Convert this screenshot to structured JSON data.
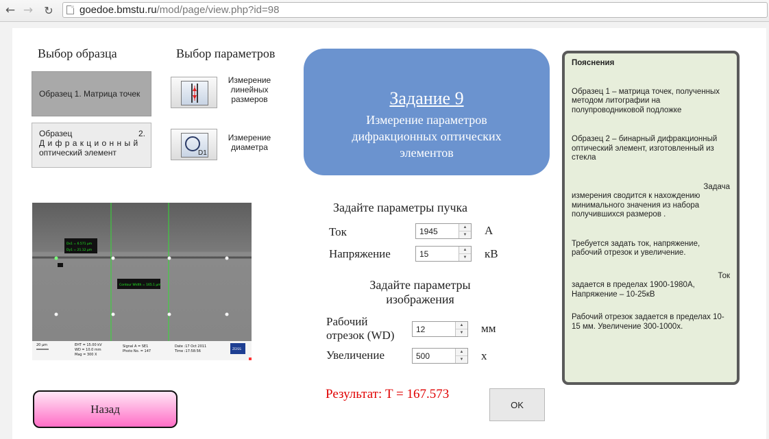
{
  "browser": {
    "url_host": "goedoe.bmstu.ru",
    "url_path": "/mod/page/view.php?id=98"
  },
  "left_panel": {
    "sample_heading": "Выбор образца",
    "param_heading": "Выбор параметров",
    "sample1_label": "Образец 1. Матрица точек",
    "sample2_line1_left": "Образец",
    "sample2_line1_right": "2.",
    "sample2_line2_words": [
      "Д и ф р а к ц и о н н ы й"
    ],
    "sample2_line3": "оптический элемент",
    "param1_label_lines": [
      "Измерение",
      "линейных",
      "размеров"
    ],
    "param2_label_lines": [
      "Измерение",
      "диаметра"
    ],
    "param2_icon_text": "D1"
  },
  "task": {
    "title": "Задание 9",
    "subtitle": "Измерение параметров дифракционных оптических элементов"
  },
  "sem_image": {
    "label_box1_line1": "Dx1 = 6.571 µm",
    "label_box1_line2": "Dy1 = 21.12 µm",
    "label_box2": "Contour Width = 165.1 µm",
    "footer_scale": "20 µm",
    "footer_eht": "EHT = 15.00 kV",
    "footer_wd": "WD = 10.0 mm",
    "footer_mag": "Mag =  300 X",
    "footer_signal": "Signal A = SE1",
    "footer_photo": "Photo No. = 147",
    "footer_date": "Date :17 Oct 2011",
    "footer_time": "Time :17:58:56",
    "footer_logo": "ZEISS"
  },
  "beam_form": {
    "heading": "Задайте параметры пучка",
    "current_label": "Ток",
    "current_value": "1945",
    "current_unit": "А",
    "voltage_label": "Напряжение",
    "voltage_value": "15",
    "voltage_unit": "кВ"
  },
  "image_form": {
    "heading_line1": "Задайте параметры",
    "heading_line2": "изображения",
    "wd_label_line1": "Рабочий",
    "wd_label_line2": "отрезок (WD)",
    "wd_value": "12",
    "wd_unit": "мм",
    "mag_label": "Увеличение",
    "mag_value": "500",
    "mag_unit": "х"
  },
  "result_text": "Результат: T = 167.573",
  "ok_label": "OK",
  "back_label": "Назад",
  "notes": {
    "title": "Пояснения",
    "p1": "Образец 1 – матрица точек, полученных методом литографии на полупроводниковой подложке",
    "p2": "Образец 2 – бинарный дифракционный оптический элемент, изготовленный из стекла",
    "p3_right": "Задача",
    "p3": "измерения сводится к нахождению минимального значения из набора получившихся размеров .",
    "p4": "Требуется задать ток, напряжение, рабочий отрезок и увеличение.",
    "p5_right": "Ток",
    "p5": "задается в пределах 1900-1980А, Напряжение – 10-25кВ",
    "p6": "Рабочий отрезок  задается в пределах 10-15 мм. Увеличение 300-1000х."
  },
  "colors": {
    "task_box": "#6b93cf",
    "notes_bg": "#e7eedb",
    "result": "#e00000",
    "back_button": "#ff6ec6"
  }
}
